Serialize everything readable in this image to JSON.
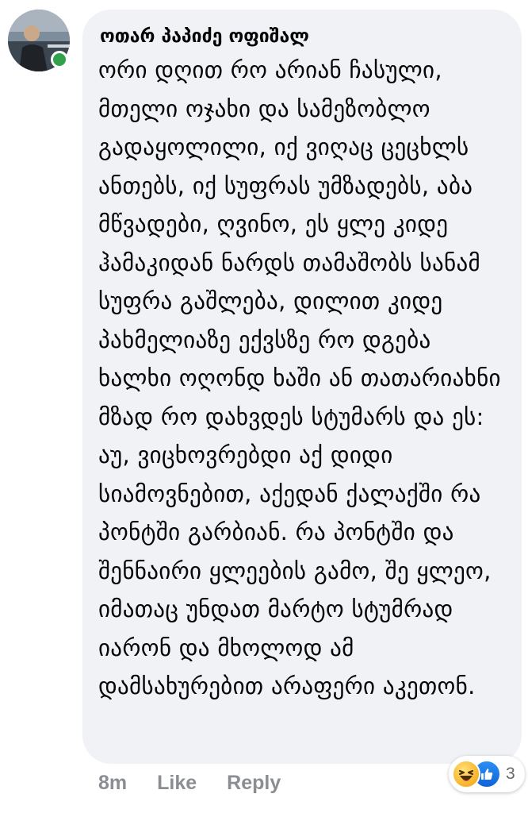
{
  "comment": {
    "author": "ოთარ პაპიძე ოფიშალ",
    "text": "ორი დღით რო არიან ჩასული, მთელი ოჯახი და სამეზობლო გადაყოლილი, იქ ვიღაც ცეცხლს ანთებს, იქ სუფრას უმზადებს, აბა მწვადები, ღვინო, ეს ყლე კიდე ჰამაკიდან ნარდს თამაშობს სანამ სუფრა გაშლება, დილით კიდე პახმელიაზე ექვსზე რო დგება ხალხი ოღონდ ხაში ან თათარიახნი მზად რო დახვდეს სტუმარს და ეს: აუ, ვიცხოვრებდი აქ დიდი სიამოვნებით, აქედან ქალაქში რა პონტში გარბიან. რა პონტში და შენნაირი ყლეების გამო, შე ყლეო, იმათაც უნდათ მარტო სტუმრად იარონ და მხოლოდ ამ დამსახურებით არაფერი აკეთონ.",
    "online": true
  },
  "actions": {
    "timestamp": "8m",
    "like_label": "Like",
    "reply_label": "Reply"
  },
  "reactions": {
    "types": [
      "haha-icon",
      "like-icon"
    ],
    "count": "3"
  },
  "colors": {
    "bubble_bg": "#f0f2f5",
    "online_green": "#31a24c",
    "meta_gray": "#8a8d91",
    "like_blue": "#1877f2",
    "haha_yellow": "#f7b125"
  }
}
